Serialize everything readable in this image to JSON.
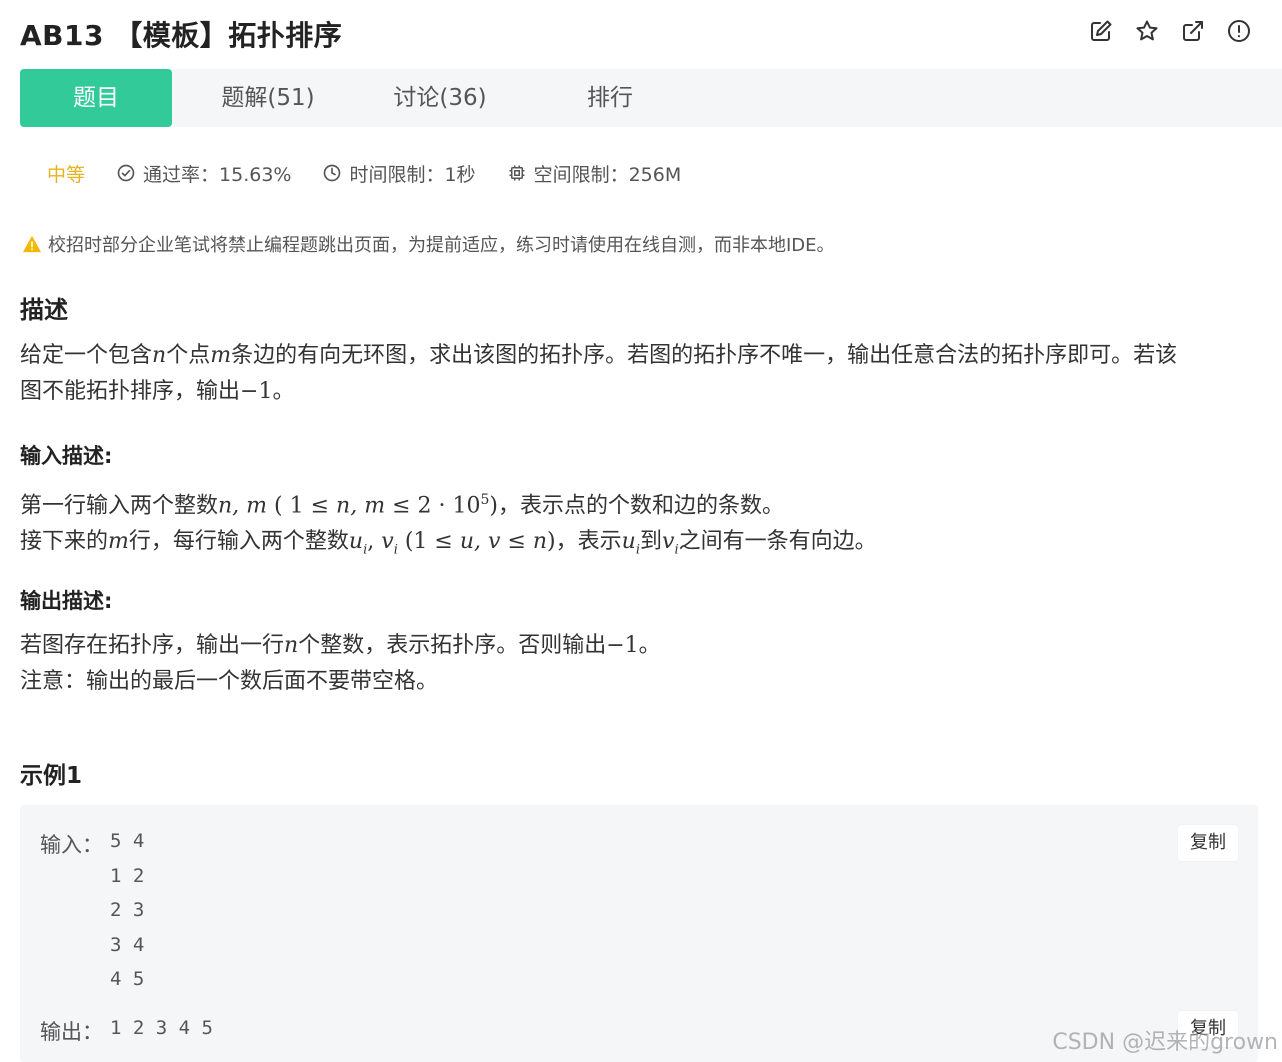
{
  "header": {
    "title": "AB13 【模板】拓扑排序",
    "icons": [
      "edit-icon",
      "star-icon",
      "external-link-icon",
      "info-icon"
    ]
  },
  "tabs": [
    {
      "label": "题目",
      "active": true
    },
    {
      "label": "题解(51)",
      "active": false
    },
    {
      "label": "讨论(36)",
      "active": false
    },
    {
      "label": "排行",
      "active": false
    }
  ],
  "meta": {
    "difficulty": "中等",
    "pass_rate": "通过率：15.63%",
    "time_limit": "时间限制：1秒",
    "memory_limit": "空间限制：256M",
    "difficulty_color": "#e6b422"
  },
  "notice": "校招时部分企业笔试将禁止编程题跳出页面，为提前适应，练习时请使用在线自测，而非本地IDE。",
  "description": {
    "heading": "描述",
    "line1_a": "给定一个包含",
    "var_n": "n",
    "line1_b": "个点",
    "var_m": "m",
    "line1_c": "条边的有向无环图，求出该图的拓扑序。若图的拓扑序不唯一，输出任意合法的拓扑序即可。若该",
    "line2_a": "图不能拓扑排序，输出",
    "neg_one": "−1",
    "line2_b": "。"
  },
  "input_desc": {
    "heading": "输入描述:",
    "l1_a": "第一行输入两个整数",
    "l1_vars": "n, m",
    "l1_cond_open": " ( 1 ≤ ",
    "l1_cond_vars": "n, m",
    "l1_cond_mid": " ≤ 2 · 10",
    "l1_exp": "5",
    "l1_cond_close": ")",
    "l1_b": "，表示点的个数和边的条数。",
    "l2_a": "接下来的",
    "l2_m": "m",
    "l2_b": "行，每行输入两个整数",
    "l2_u": "u",
    "l2_sub1": "i",
    "l2_comma": ", ",
    "l2_v": "v",
    "l2_sub2": "i",
    "l2_cond_open": " (1 ≤ ",
    "l2_cond_vars": "u, v",
    "l2_cond_mid": " ≤ ",
    "l2_cond_n": "n",
    "l2_cond_close": ")",
    "l2_c": "，表示",
    "l2_u2": "u",
    "l2_sub3": "i",
    "l2_d": "到",
    "l2_v2": "v",
    "l2_sub4": "i",
    "l2_e": "之间有一条有向边。"
  },
  "output_desc": {
    "heading": "输出描述:",
    "l1_a": "若图存在拓扑序，输出一行",
    "l1_n": "n",
    "l1_b": "个整数，表示拓扑序。否则输出",
    "l1_neg": "−1",
    "l1_c": "。",
    "l2": "注意：输出的最后一个数后面不要带空格。"
  },
  "example": {
    "heading": "示例1",
    "input_label": "输入：",
    "input_value": "5 4\n1 2\n2 3\n3 4\n4 5",
    "output_label": "输出：",
    "output_value": "1 2 3 4 5",
    "copy_label": "复制"
  },
  "watermark": "CSDN @迟来的grown",
  "colors": {
    "accent": "#32ca99",
    "tabbar_bg": "#f5f6f7"
  }
}
